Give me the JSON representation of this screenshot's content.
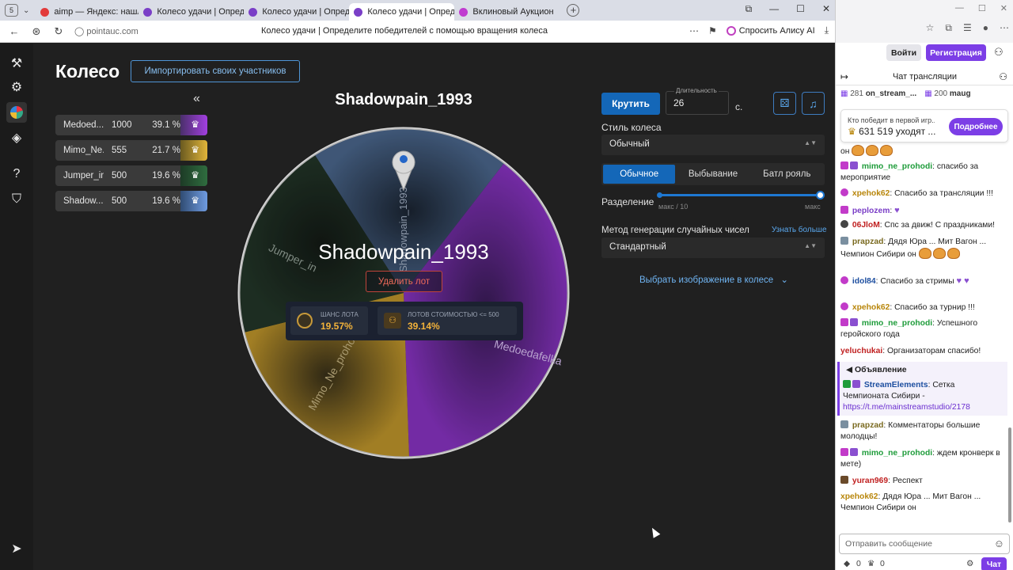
{
  "browser": {
    "tab_count": "5",
    "tabs": [
      {
        "title": "aimp — Яндекс: нашлось",
        "color": "#e23b3b"
      },
      {
        "title": "Колесо удачи | Определи",
        "color": "#7a3fc7"
      },
      {
        "title": "Колесо удачи | Определи",
        "color": "#7a3fc7"
      },
      {
        "title": "Колесо удачи | Опреде",
        "color": "#7a3fc7",
        "active": true
      },
      {
        "title": "Вклиновый Аукцион",
        "color": "#c03bd0"
      }
    ],
    "url": "pointauc.com",
    "page_title": "Колесо удачи | Определите победителей с помощью вращения колеса",
    "alice_label": "Спросить Алису AI"
  },
  "app": {
    "title": "Колесо",
    "import_button": "Импортировать своих участников",
    "collapse_icon": "«",
    "lots": [
      {
        "name": "Medoed...",
        "amount": "1000",
        "percent": "39.1 %",
        "gradient": [
          "#4a2f6b",
          "#a23fe0"
        ]
      },
      {
        "name": "Mimo_Ne...",
        "amount": "555",
        "percent": "21.7 %",
        "gradient": [
          "#6a5a20",
          "#e0b43a"
        ]
      },
      {
        "name": "Jumper_in",
        "amount": "500",
        "percent": "19.6 %",
        "gradient": [
          "#1d3b26",
          "#2f6d3f"
        ]
      },
      {
        "name": "Shadow...",
        "amount": "500",
        "percent": "19.6 %",
        "gradient": [
          "#304c73",
          "#6f9be0"
        ]
      }
    ],
    "winner_top": "Shadowpain_1993",
    "wheel": {
      "center_name": "Shadowpain_1993",
      "remove_button": "Удалить лот",
      "labels": [
        "Shadowpain_1993",
        "Medoedafelka",
        "Mimo_Ne_prohodi",
        "Jumper_in"
      ],
      "chance_label": "ШАНС ЛОТА",
      "chance_value": "19.57%",
      "lots_label": "ЛОТОВ СТОИМОСТЬЮ <= 500",
      "lots_value": "39.14%"
    },
    "controls": {
      "spin_button": "Крутить",
      "duration_label": "Длительность",
      "duration_value": "26",
      "duration_unit": "с.",
      "wheel_style_label": "Стиль колеса",
      "wheel_style_value": "Обычный",
      "modes": [
        "Обычное",
        "Выбывание",
        "Батл рояль"
      ],
      "active_mode": "Обычное",
      "split_label": "Разделение",
      "split_min": "макс / 10",
      "split_max": "макс",
      "rng_label": "Метод генерации случайных чисел",
      "learn_more": "Узнать больше",
      "rng_value": "Стандартный",
      "image_select": "Выбрать изображение в колесе"
    }
  },
  "twitch": {
    "login": "Войти",
    "register": "Регистрация",
    "chat_title": "Чат трансляции",
    "gifters": [
      {
        "count": "281",
        "name": "on_stream_..."
      },
      {
        "count": "200",
        "name": "maug"
      }
    ],
    "prediction_question": "Кто победит в первой игр...",
    "prediction_value": "631 519 уходят ...",
    "prediction_button": "Подробнее",
    "messages": [
      {
        "user": "",
        "color": "#222",
        "text": "он",
        "emotes": 3
      },
      {
        "user": "mimo_ne_prohodi",
        "color": "#1e9c3a",
        "text": "спасибо за мероприятие"
      },
      {
        "user": "xpehok62",
        "color": "#b8860b",
        "text": "Спасибо за трансляции !!!"
      },
      {
        "user": "peplozem",
        "color": "#7b3fc7",
        "text": ""
      },
      {
        "user": "06JloM",
        "color": "#c02020",
        "text": "Спс за движ! С праздниками!"
      },
      {
        "user": "prapzad",
        "color": "#7a6a20",
        "text": "Дядя Юра ... Мит Вагон ... Чемпион Сибири он"
      },
      {
        "user": "idol84",
        "color": "#1e4fa0",
        "text": "Спасибо за стримы"
      },
      {
        "user": "xpehok62",
        "color": "#b8860b",
        "text": "Спасибо за турнир !!!"
      },
      {
        "user": "mimo_ne_prohodi",
        "color": "#1e9c3a",
        "text": "Успешного геройского года"
      },
      {
        "user": "yeluchukai",
        "color": "#c02020",
        "text": "Организаторам спасибо!"
      },
      {
        "user": "prapzad",
        "color": "#7a6a20",
        "text": "Комментаторы большие молодцы!"
      },
      {
        "user": "mimo_ne_prohodi",
        "color": "#1e9c3a",
        "text": "ждем кронверк в мете)"
      },
      {
        "user": "yuran969",
        "color": "#c02020",
        "text": "Респект"
      },
      {
        "user": "xpehok62",
        "color": "#b8860b",
        "text": "Дядя Юра ... Мит Вагон ... Чемпион Сибири он"
      }
    ],
    "announcement": {
      "title": "Объявление",
      "user": "StreamElements",
      "text": "Сетка Чемпионата Сибири -",
      "link": "https://t.me/mainstreamstudio/2178"
    },
    "input_placeholder": "Отправить сообщение",
    "chat_button": "Чат",
    "points": "0",
    "bits": "0"
  }
}
